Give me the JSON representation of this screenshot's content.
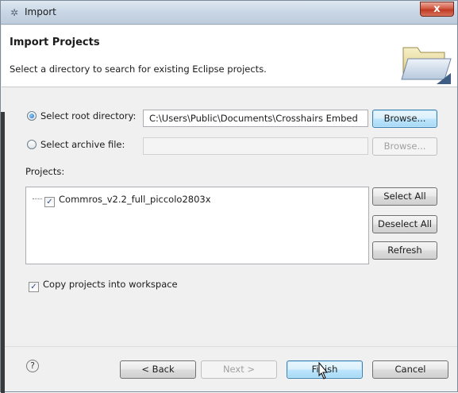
{
  "window": {
    "title": "Import",
    "close_label": "x"
  },
  "header": {
    "title": "Import Projects",
    "description": "Select a directory to search for existing Eclipse projects."
  },
  "source": {
    "root_directory_label": "Select root directory:",
    "root_directory_value": "C:\\Users\\Public\\Documents\\Crosshairs Embed",
    "root_browse_label": "Browse...",
    "archive_file_label": "Select archive file:",
    "archive_file_value": "",
    "archive_browse_label": "Browse...",
    "selected": "root_directory"
  },
  "projects": {
    "label": "Projects:",
    "items": [
      {
        "name": "Commros_v2.2_full_piccolo2803x",
        "checked": true
      }
    ],
    "select_all_label": "Select All",
    "deselect_all_label": "Deselect All",
    "refresh_label": "Refresh"
  },
  "options": {
    "copy_into_workspace_label": "Copy projects into workspace",
    "copy_into_workspace_checked": true
  },
  "footer": {
    "help_icon": "?",
    "back_label": "< Back",
    "next_label": "Next >",
    "finish_label": "Finish",
    "cancel_label": "Cancel"
  },
  "icons": {
    "title": "gear-icon",
    "header": "folder-open-icon",
    "help": "help-icon",
    "cursor": "mouse-pointer-icon"
  }
}
